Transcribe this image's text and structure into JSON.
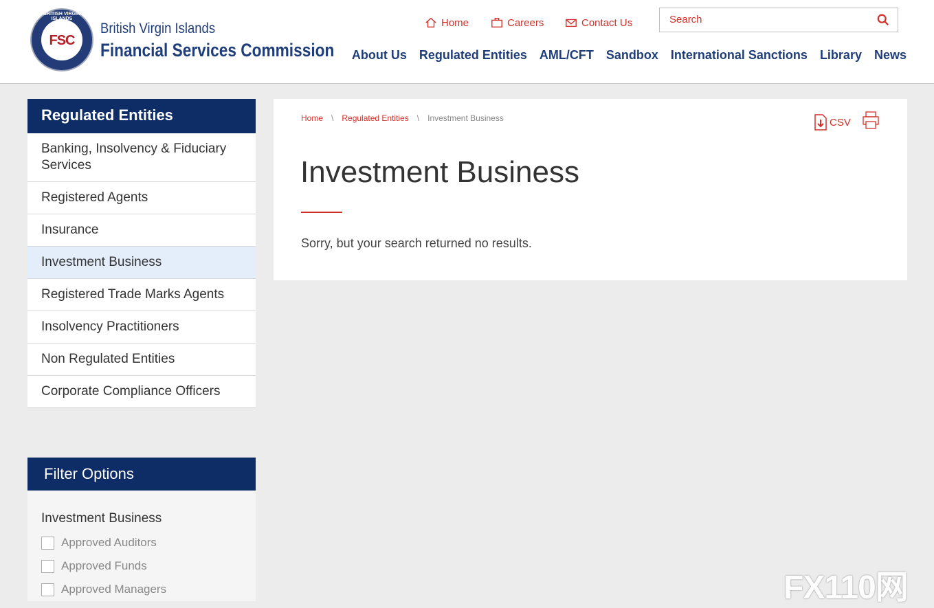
{
  "brand": {
    "line1": "British Virgin Islands",
    "line2": "Financial Services Commission",
    "logo_text": "FSC",
    "logo_ring": "BRITISH VIRGIN ISLANDS"
  },
  "utility_nav": {
    "home": "Home",
    "careers": "Careers",
    "contact": "Contact Us"
  },
  "search": {
    "placeholder": "Search"
  },
  "main_nav": [
    "About Us",
    "Regulated Entities",
    "AML/CFT",
    "Sandbox",
    "International Sanctions",
    "Library",
    "News"
  ],
  "sidebar": {
    "title": "Regulated Entities",
    "items": [
      {
        "label": "Banking, Insolvency & Fiduciary Services"
      },
      {
        "label": "Registered Agents"
      },
      {
        "label": "Insurance"
      },
      {
        "label": "Investment Business",
        "active": true
      },
      {
        "label": "Registered Trade Marks Agents"
      },
      {
        "label": "Insolvency Practitioners"
      },
      {
        "label": "Non Regulated Entities"
      },
      {
        "label": "Corporate Compliance Officers"
      }
    ]
  },
  "filter": {
    "title": "Filter Options",
    "group": "Investment Business",
    "options": [
      {
        "label": "Approved Auditors",
        "checked": false
      },
      {
        "label": "Approved Funds",
        "checked": false
      },
      {
        "label": "Approved Managers",
        "checked": false
      }
    ]
  },
  "breadcrumb": {
    "home": "Home",
    "section": "Regulated Entities",
    "current": "Investment Business",
    "sep": "\\"
  },
  "page": {
    "title": "Investment Business",
    "message": "Sorry, but your search returned no results."
  },
  "actions": {
    "csv": "CSV"
  },
  "watermark": "FX110网",
  "colors": {
    "navy": "#0e2d66",
    "accent": "#d1302a",
    "active_bg": "#e4eefb"
  }
}
